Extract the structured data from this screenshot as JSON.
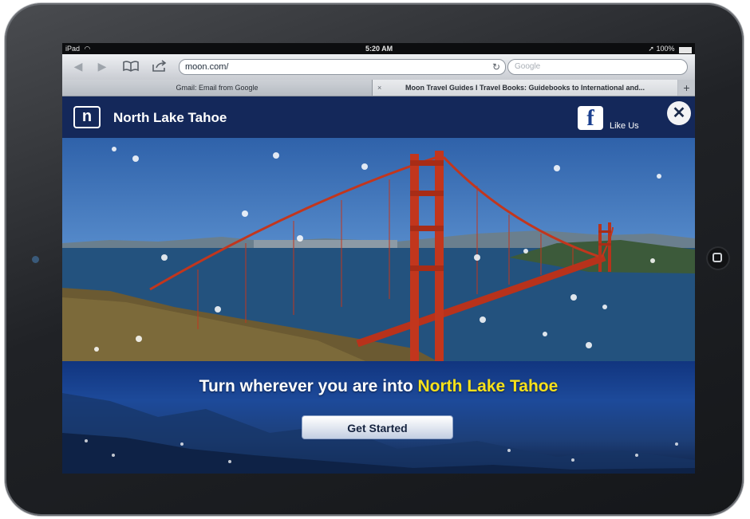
{
  "status_bar": {
    "device": "iPad",
    "time": "5:20 AM",
    "battery": "100%"
  },
  "browser": {
    "url": "moon.com/",
    "search_placeholder": "Google",
    "tabs": [
      {
        "label": "Gmail: Email from Google"
      },
      {
        "label": "Moon Travel Guides I Travel Books: Guidebooks to International and..."
      }
    ],
    "new_tab_label": "+"
  },
  "page": {
    "logo_letter": "n",
    "title": "North Lake Tahoe",
    "like_label": "Like Us",
    "close_label": "✕",
    "tagline_prefix": "Turn wherever you are into ",
    "tagline_accent": "North Lake Tahoe",
    "cta_label": "Get Started"
  },
  "colors": {
    "header_bg": "#14285a",
    "accent_yellow": "#f7e11b",
    "bridge_red": "#c2361d"
  },
  "icons": [
    "back-icon",
    "forward-icon",
    "bookmarks-icon",
    "share-icon",
    "reload-icon",
    "facebook-icon",
    "close-icon",
    "wifi-icon",
    "battery-icon"
  ]
}
